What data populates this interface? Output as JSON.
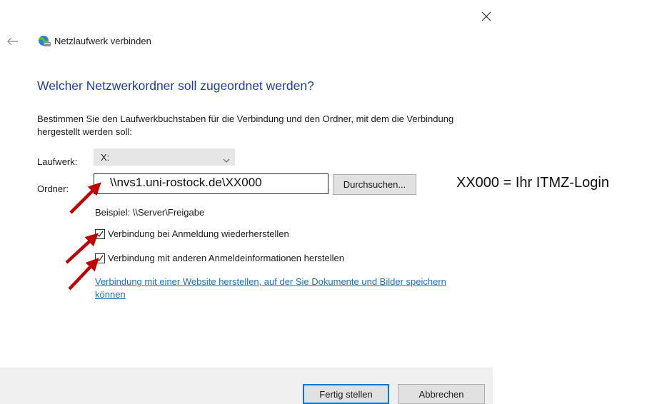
{
  "window": {
    "title": "Netzlaufwerk verbinden",
    "close_icon": "close-icon",
    "back_icon": "back-arrow-icon",
    "app_icon": "network-drive-icon"
  },
  "main": {
    "heading": "Welcher Netzwerkordner soll zugeordnet werden?",
    "instructions": "Bestimmen Sie den Laufwerkbuchstaben für die Verbindung und den Ordner, mit dem die Verbindung hergestellt werden soll:",
    "drive": {
      "label": "Laufwerk:",
      "value": "X:"
    },
    "folder": {
      "label": "Ordner:",
      "value": "\\\\nvs1.uni-rostock.de\\XX000"
    },
    "browse_label": "Durchsuchen...",
    "example": "Beispiel: \\\\Server\\Freigabe",
    "options": [
      {
        "label": "Verbindung bei Anmeldung wiederherstellen",
        "checked": true
      },
      {
        "label": "Verbindung mit anderen Anmeldeinformationen herstellen",
        "checked": true
      }
    ],
    "website_link": "Verbindung mit einer Website herstellen, auf der Sie Dokumente und Bilder speichern können"
  },
  "annotation": {
    "text": "XX000 = Ihr ITMZ-Login",
    "arrow_color": "#c00000"
  },
  "footer": {
    "finish_label": "Fertig stellen",
    "cancel_label": "Abbrechen"
  },
  "colors": {
    "heading": "#1f3f9e",
    "link": "#1f6fb5",
    "default_button_border": "#0078d7"
  }
}
